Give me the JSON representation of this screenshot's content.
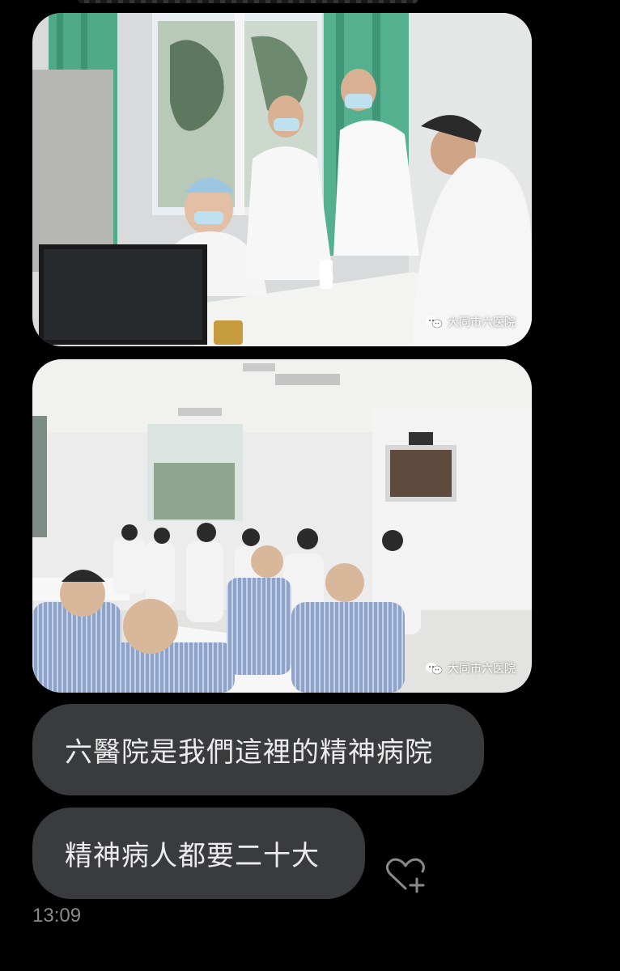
{
  "messages": [
    {
      "type": "image",
      "watermark": "大同市六医院",
      "watermark_icon": "wechat-icon",
      "alt_scene": "doctors-at-computer"
    },
    {
      "type": "image",
      "watermark": "大同市六医院",
      "watermark_icon": "wechat-icon",
      "alt_scene": "patients-watching-tv"
    },
    {
      "type": "text",
      "text": "六醫院是我們這裡的精神病院"
    },
    {
      "type": "text",
      "text": "精神病人都要二十大"
    }
  ],
  "reaction_button": {
    "icon": "heart-plus-icon",
    "color": "#8a8a8a"
  },
  "timestamp": "13:09",
  "colors": {
    "background": "#000000",
    "bubble": "#3a3b3d",
    "bubble_text": "#ececec",
    "timestamp": "#8a8a8a"
  }
}
